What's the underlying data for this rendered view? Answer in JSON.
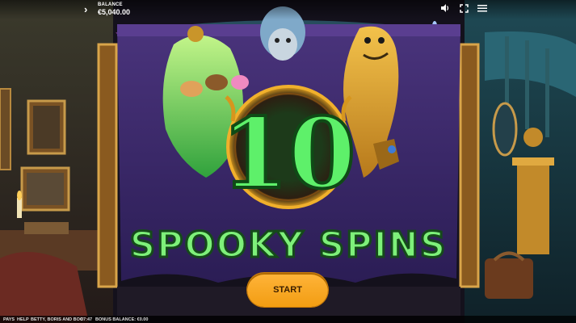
{
  "header": {
    "balance_label": "BALANCE",
    "balance_value": "€5,040.00",
    "icons": [
      "menu-arrow-icon",
      "sound-icon",
      "fullscreen-icon",
      "hamburger-menu-icon"
    ]
  },
  "bonus_screen": {
    "spins_count": "10",
    "title": "SPOOKY SPINS",
    "start_label": "START"
  },
  "footer": {
    "pays": "PAYS",
    "help": "HELP",
    "game_name": "BETTY, BORIS AND BOO",
    "time": "07:47",
    "bonus_balance": "BONUS BALANCE: €0.00"
  },
  "colors": {
    "banner_purple": "#3e2a6e",
    "slime_green": "#5ee06a",
    "ring_gold": "#d68a18",
    "button_orange": "#f7a51f"
  }
}
